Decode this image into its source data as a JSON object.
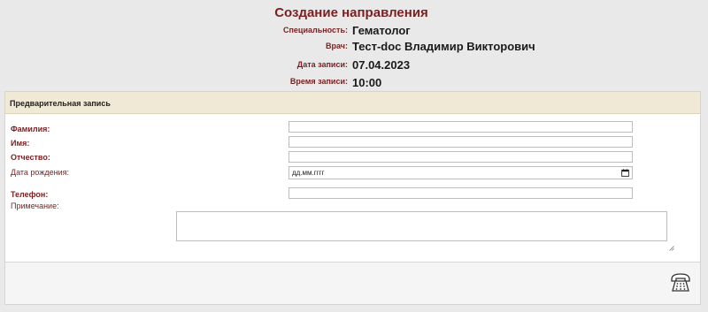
{
  "header": {
    "title": "Создание направления",
    "specialty_label": "Специальность:",
    "specialty_value": "Гематолог",
    "doctor_label": "Врач:",
    "doctor_value": "Тест-doc Владимир Викторович",
    "date_label": "Дата записи:",
    "date_value": "07.04.2023",
    "time_label": "Время записи:",
    "time_value": "10:00"
  },
  "form": {
    "panel_title": "Предварительная запись",
    "last_name_label": "Фамилия:",
    "first_name_label": "Имя:",
    "middle_name_label": "Отчество:",
    "birth_date_label": "Дата рождения:",
    "birth_date_placeholder": "дд.мм.гггг",
    "phone_label": "Телефон:",
    "note_label": "Примечание:",
    "last_name_value": "",
    "first_name_value": "",
    "middle_name_value": "",
    "phone_value": "",
    "note_value": ""
  },
  "icons": {
    "calendar": "calendar-icon",
    "resize": "resize-handle-icon",
    "phone": "phone-icon"
  },
  "colors": {
    "accent": "#7a1f1f",
    "panel_header_bg": "#f0e9d6",
    "page_bg": "#e9e9e9"
  }
}
